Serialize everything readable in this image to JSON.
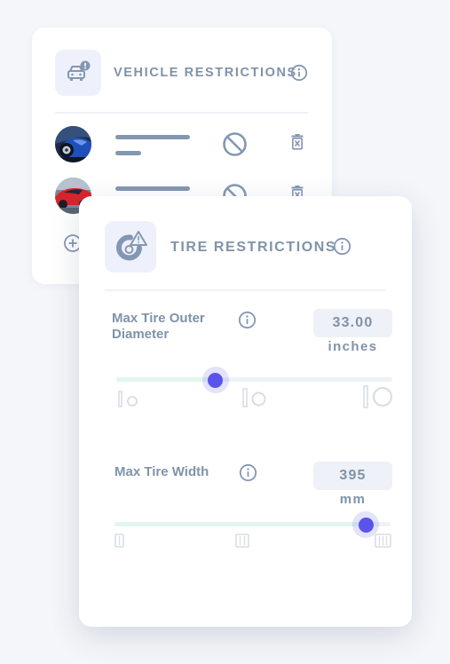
{
  "colors": {
    "page_background": "#f4f6f9",
    "card_background": "#ffffff",
    "title_text": "#7f93aa",
    "icon_tint": "#8497b2",
    "slider_thumb": "#5a54eb",
    "slider_fill": "#e3f6ee"
  },
  "vehicle_card": {
    "title": "VEHICLE RESTRICTIONS",
    "header_icon": "vehicle-alert-icon",
    "vehicles": [
      {
        "avatar": "blue-car-photo",
        "action_icon": "ban-icon",
        "delete_icon": "trash-icon"
      },
      {
        "avatar": "red-car-photo",
        "action_icon": "ban-icon",
        "delete_icon": "trash-icon"
      }
    ],
    "add_icon": "add-circle-icon"
  },
  "tire_card": {
    "title": "TIRE RESTRICTIONS",
    "header_icon": "tire-alert-icon",
    "diameter": {
      "label": "Max Tire Outer Diameter",
      "value": "33.00",
      "unit": "inches",
      "slider_fraction": 0.36,
      "tick_icons": [
        "tire-small-icon",
        "tire-medium-icon",
        "tire-large-icon"
      ]
    },
    "width": {
      "label": "Max Tire Width",
      "value": "395",
      "unit": "mm",
      "slider_fraction": 0.91,
      "tick_icons": [
        "tread-narrow-icon",
        "tread-medium-icon",
        "tread-wide-icon"
      ]
    }
  }
}
